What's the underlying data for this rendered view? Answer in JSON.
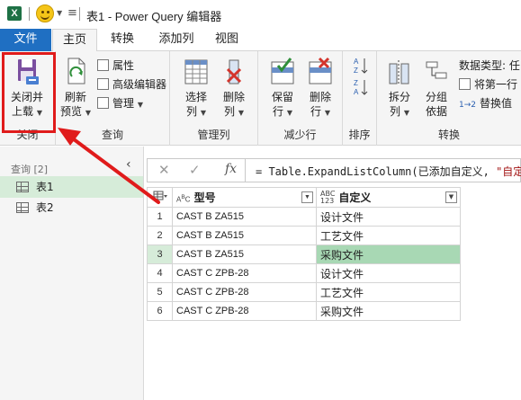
{
  "titlebar": {
    "app_icon_letter": "X",
    "title": "表1 - Power Query 编辑器"
  },
  "tabs": [
    "文件",
    "主页",
    "转换",
    "添加列",
    "视图"
  ],
  "ribbon": {
    "close_group": {
      "button": "关闭并",
      "button2": "上载",
      "label": "关闭"
    },
    "query_group": {
      "refresh": "刷新",
      "refresh2": "预览",
      "properties": "属性",
      "advanced_editor": "高级编辑器",
      "manage": "管理",
      "label": "查询"
    },
    "manage_cols_group": {
      "choose": "选择",
      "choose2": "列",
      "remove": "删除",
      "remove2": "列",
      "label": "管理列"
    },
    "reduce_rows_group": {
      "keep": "保留",
      "keep2": "行",
      "remove": "删除",
      "remove2": "行",
      "label": "减少行"
    },
    "sort_group": {
      "label": "排序"
    },
    "transform_group": {
      "split": "拆分",
      "split2": "列",
      "group": "分组",
      "group2": "依据",
      "datatype": "数据类型: 任",
      "first_row": "将第一行",
      "replace": "替换值",
      "label": "转换"
    }
  },
  "queries": {
    "header": "查询 [2]",
    "items": [
      "表1",
      "表2"
    ],
    "selected": 0
  },
  "formula": {
    "prefix": "= Table.ExpandListColumn(已添加自定义, ",
    "string": "\"自定义"
  },
  "grid": {
    "columns": [
      {
        "type_icon": "ABC",
        "name": "型号"
      },
      {
        "type_icon": "ABC123",
        "name": "自定义"
      }
    ],
    "rows": [
      {
        "n": "1",
        "model": "CAST B ZA515",
        "custom": "设计文件"
      },
      {
        "n": "2",
        "model": "CAST B ZA515",
        "custom": "工艺文件"
      },
      {
        "n": "3",
        "model": "CAST B ZA515",
        "custom": "采购文件"
      },
      {
        "n": "4",
        "model": "CAST C ZPB-28",
        "custom": "设计文件"
      },
      {
        "n": "5",
        "model": "CAST C ZPB-28",
        "custom": "工艺文件"
      },
      {
        "n": "6",
        "model": "CAST C ZPB-28",
        "custom": "采购文件"
      }
    ],
    "selected_row": 3
  },
  "colors": {
    "file_tab": "#1f6fc2",
    "highlight": "#e01b1b",
    "selected_cell": "#a8d8b4",
    "column_accent": "#1fa383"
  }
}
